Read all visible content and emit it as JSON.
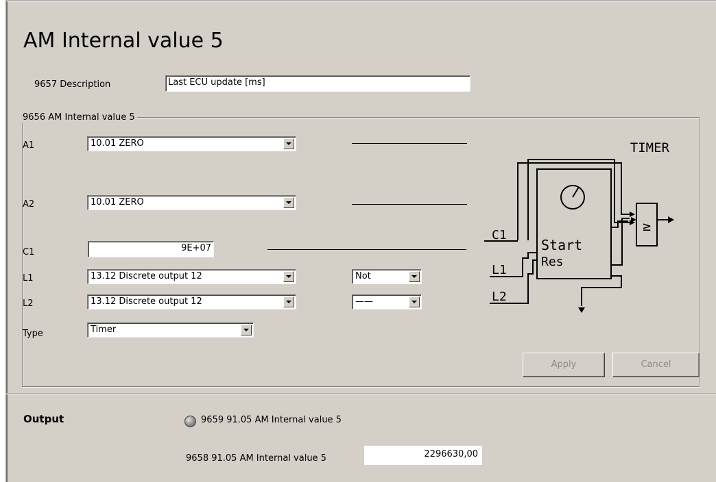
{
  "page": {
    "title": "AM Internal value 5"
  },
  "description": {
    "label": "9657 Description",
    "value": "Last ECU update [ms]"
  },
  "group": {
    "legend": "9656 AM Internal value 5",
    "a1": {
      "label": "A1",
      "value": "10.01 ZERO"
    },
    "a2": {
      "label": "A2",
      "value": "10.01 ZERO"
    },
    "c1": {
      "label": "C1",
      "value": "9E+07"
    },
    "l1": {
      "label": "L1",
      "value": "13.12 Discrete output 12",
      "modifier": "Not"
    },
    "l2": {
      "label": "L2",
      "value": "13.12 Discrete output 12",
      "modifier": "——"
    },
    "type": {
      "label": "Type",
      "value": "Timer"
    },
    "apply_label": "Apply",
    "cancel_label": "Cancel"
  },
  "diagram": {
    "title": "TIMER",
    "start_label": "Start",
    "res_label": "Res",
    "c1_label": "C1",
    "l1_label": "L1",
    "l2_label": "L2",
    "compare_symbol": "≥"
  },
  "output": {
    "label": "Output",
    "status_label": "9659 91.05 AM Internal value 5",
    "value_label": "9658 91.05 AM Internal value 5",
    "value": "2296630,00"
  }
}
